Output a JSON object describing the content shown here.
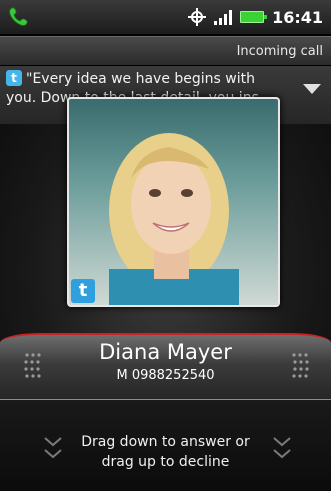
{
  "status_bar": {
    "time": "16:41",
    "icons": [
      "phone-icon",
      "gps-icon",
      "signal-icon",
      "battery-icon"
    ]
  },
  "header": {
    "label": "Incoming call"
  },
  "tweet": {
    "line1": "\"Every idea we have begins with",
    "line2": "you. Down to the last detail, you ins..."
  },
  "caller": {
    "name": "Diana Mayer",
    "number": "M 0988252540"
  },
  "hint": {
    "line1": "Drag down to answer or",
    "line2": "drag up to decline"
  },
  "colors": {
    "decline": "#cc2222",
    "answer": "#3ac83a",
    "twitter": "#2f9fe0"
  }
}
